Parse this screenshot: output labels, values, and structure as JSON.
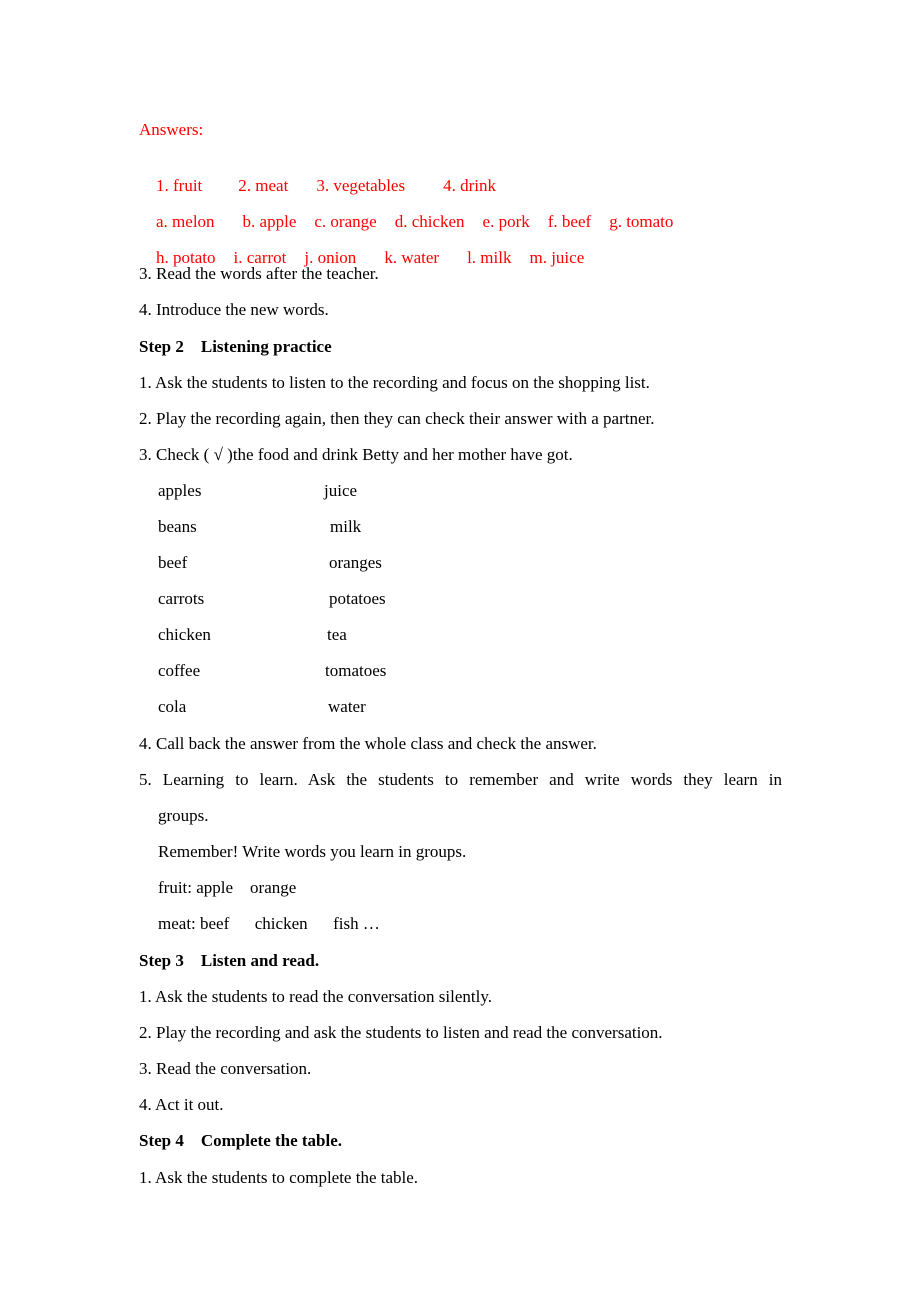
{
  "answers": {
    "heading": "Answers:",
    "categories": [
      "1. fruit",
      "2. meat",
      "3. vegetables",
      "4. drink"
    ],
    "row1": [
      "a. melon",
      "b. apple",
      "c. orange",
      "d. chicken",
      "e. pork",
      "f. beef",
      "g. tomato"
    ],
    "row2": [
      "h. potato",
      "i. carrot",
      "j. onion",
      "k. water",
      "l. milk",
      "m. juice"
    ]
  },
  "step1_items": [
    "3. Read the words after the teacher.",
    "4. Introduce the new words."
  ],
  "step2": {
    "title": "Step 2    Listening practice",
    "items": [
      "1. Ask the students to listen to the recording and focus on the shopping list.",
      "2. Play the recording again, then they can check their answer with a partner.",
      "3. Check ( √ )the food and drink Betty and her mother have got."
    ],
    "checklist_left": [
      "apples",
      "beans",
      "beef",
      "carrots",
      "chicken",
      "coffee",
      "cola"
    ],
    "checklist_right": [
      "juice",
      "milk",
      "oranges",
      "potatoes",
      "tea",
      "tomatoes",
      "water"
    ],
    "item4": "4. Call back the answer from the whole class and check the answer.",
    "item5_line1": "5. Learning to learn. Ask the students to remember and write words they learn in",
    "item5_line2": "groups.",
    "remember": "Remember! Write words you learn in groups.",
    "fruit_line": "fruit: apple    orange",
    "meat_line": "meat: beef      chicken      fish …"
  },
  "step3": {
    "title": "Step 3    Listen and read.",
    "items": [
      "1. Ask the students to read the conversation silently.",
      "2. Play the recording and ask the students to listen and read the conversation.",
      "3. Read the conversation.",
      "4. Act it out."
    ]
  },
  "step4": {
    "title": "Step 4    Complete the table.",
    "items": [
      "1. Ask the students to complete the table."
    ]
  }
}
